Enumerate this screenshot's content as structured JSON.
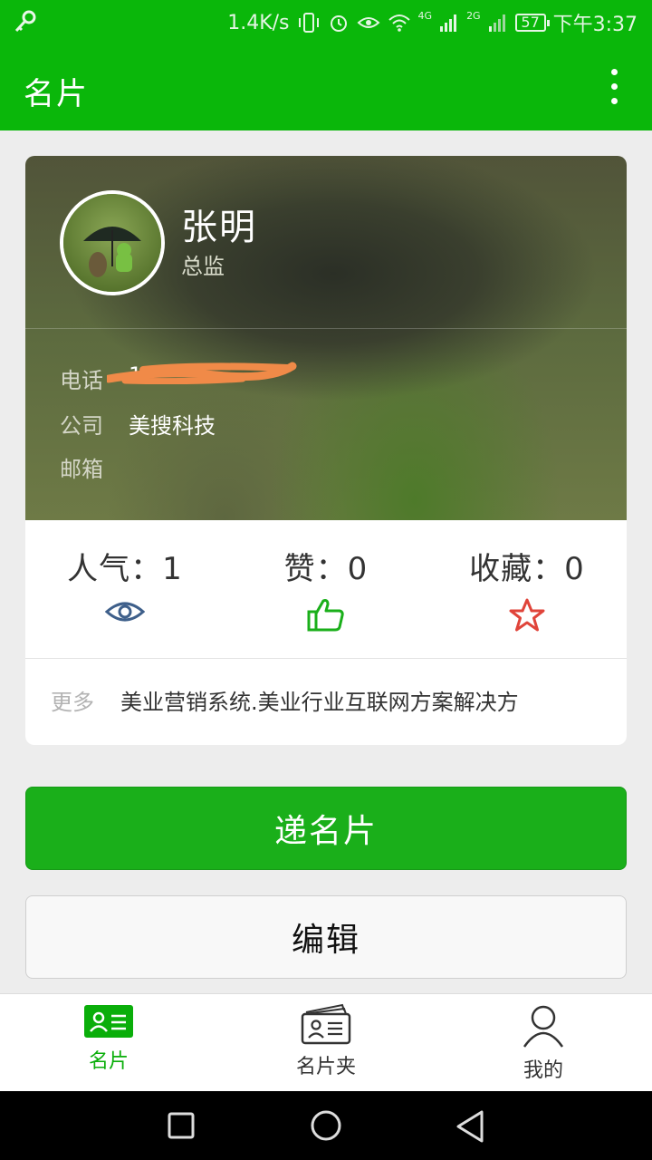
{
  "status_bar": {
    "speed": "1.4K/s",
    "net_4g": "4G",
    "net_2g": "2G",
    "battery": "57",
    "time": "下午3:37"
  },
  "header": {
    "title": "名片"
  },
  "card": {
    "name": "张明",
    "role": "总监",
    "fields": [
      {
        "label": "电话",
        "value": "1"
      },
      {
        "label": "公司",
        "value": "美搜科技"
      },
      {
        "label": "邮箱",
        "value": ""
      }
    ],
    "stats": [
      {
        "text": "人气：1",
        "icon": "eye-icon",
        "color": "#3e5f8a"
      },
      {
        "text": "赞：0",
        "icon": "thumbs-up-icon",
        "color": "#1aaf1a"
      },
      {
        "text": "收藏：0",
        "icon": "star-icon",
        "color": "#e0443a"
      }
    ],
    "more": {
      "label": "更多",
      "value": "美业营销系统.美业行业互联网方案解决方"
    }
  },
  "actions": {
    "send_card": "递名片",
    "edit": "编辑"
  },
  "bottom_nav": [
    {
      "label": "名片",
      "icon": "card-icon",
      "active": true
    },
    {
      "label": "名片夹",
      "icon": "card-holder-icon",
      "active": false
    },
    {
      "label": "我的",
      "icon": "person-icon",
      "active": false
    }
  ],
  "colors": {
    "brand_green": "#0ab70a",
    "button_green": "#1aaf1a"
  }
}
